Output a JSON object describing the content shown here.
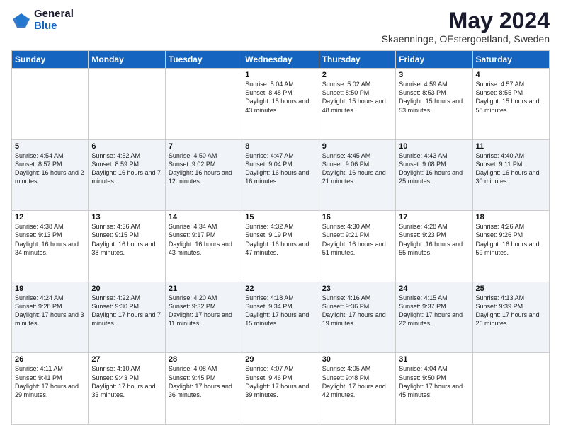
{
  "header": {
    "logo_general": "General",
    "logo_blue": "Blue",
    "month_title": "May 2024",
    "location": "Skaenninge, OEstergoetland, Sweden"
  },
  "days_of_week": [
    "Sunday",
    "Monday",
    "Tuesday",
    "Wednesday",
    "Thursday",
    "Friday",
    "Saturday"
  ],
  "weeks": [
    [
      {
        "day": "",
        "info": ""
      },
      {
        "day": "",
        "info": ""
      },
      {
        "day": "",
        "info": ""
      },
      {
        "day": "1",
        "info": "Sunrise: 5:04 AM\nSunset: 8:48 PM\nDaylight: 15 hours\nand 43 minutes."
      },
      {
        "day": "2",
        "info": "Sunrise: 5:02 AM\nSunset: 8:50 PM\nDaylight: 15 hours\nand 48 minutes."
      },
      {
        "day": "3",
        "info": "Sunrise: 4:59 AM\nSunset: 8:53 PM\nDaylight: 15 hours\nand 53 minutes."
      },
      {
        "day": "4",
        "info": "Sunrise: 4:57 AM\nSunset: 8:55 PM\nDaylight: 15 hours\nand 58 minutes."
      }
    ],
    [
      {
        "day": "5",
        "info": "Sunrise: 4:54 AM\nSunset: 8:57 PM\nDaylight: 16 hours\nand 2 minutes."
      },
      {
        "day": "6",
        "info": "Sunrise: 4:52 AM\nSunset: 8:59 PM\nDaylight: 16 hours\nand 7 minutes."
      },
      {
        "day": "7",
        "info": "Sunrise: 4:50 AM\nSunset: 9:02 PM\nDaylight: 16 hours\nand 12 minutes."
      },
      {
        "day": "8",
        "info": "Sunrise: 4:47 AM\nSunset: 9:04 PM\nDaylight: 16 hours\nand 16 minutes."
      },
      {
        "day": "9",
        "info": "Sunrise: 4:45 AM\nSunset: 9:06 PM\nDaylight: 16 hours\nand 21 minutes."
      },
      {
        "day": "10",
        "info": "Sunrise: 4:43 AM\nSunset: 9:08 PM\nDaylight: 16 hours\nand 25 minutes."
      },
      {
        "day": "11",
        "info": "Sunrise: 4:40 AM\nSunset: 9:11 PM\nDaylight: 16 hours\nand 30 minutes."
      }
    ],
    [
      {
        "day": "12",
        "info": "Sunrise: 4:38 AM\nSunset: 9:13 PM\nDaylight: 16 hours\nand 34 minutes."
      },
      {
        "day": "13",
        "info": "Sunrise: 4:36 AM\nSunset: 9:15 PM\nDaylight: 16 hours\nand 38 minutes."
      },
      {
        "day": "14",
        "info": "Sunrise: 4:34 AM\nSunset: 9:17 PM\nDaylight: 16 hours\nand 43 minutes."
      },
      {
        "day": "15",
        "info": "Sunrise: 4:32 AM\nSunset: 9:19 PM\nDaylight: 16 hours\nand 47 minutes."
      },
      {
        "day": "16",
        "info": "Sunrise: 4:30 AM\nSunset: 9:21 PM\nDaylight: 16 hours\nand 51 minutes."
      },
      {
        "day": "17",
        "info": "Sunrise: 4:28 AM\nSunset: 9:23 PM\nDaylight: 16 hours\nand 55 minutes."
      },
      {
        "day": "18",
        "info": "Sunrise: 4:26 AM\nSunset: 9:26 PM\nDaylight: 16 hours\nand 59 minutes."
      }
    ],
    [
      {
        "day": "19",
        "info": "Sunrise: 4:24 AM\nSunset: 9:28 PM\nDaylight: 17 hours\nand 3 minutes."
      },
      {
        "day": "20",
        "info": "Sunrise: 4:22 AM\nSunset: 9:30 PM\nDaylight: 17 hours\nand 7 minutes."
      },
      {
        "day": "21",
        "info": "Sunrise: 4:20 AM\nSunset: 9:32 PM\nDaylight: 17 hours\nand 11 minutes."
      },
      {
        "day": "22",
        "info": "Sunrise: 4:18 AM\nSunset: 9:34 PM\nDaylight: 17 hours\nand 15 minutes."
      },
      {
        "day": "23",
        "info": "Sunrise: 4:16 AM\nSunset: 9:36 PM\nDaylight: 17 hours\nand 19 minutes."
      },
      {
        "day": "24",
        "info": "Sunrise: 4:15 AM\nSunset: 9:37 PM\nDaylight: 17 hours\nand 22 minutes."
      },
      {
        "day": "25",
        "info": "Sunrise: 4:13 AM\nSunset: 9:39 PM\nDaylight: 17 hours\nand 26 minutes."
      }
    ],
    [
      {
        "day": "26",
        "info": "Sunrise: 4:11 AM\nSunset: 9:41 PM\nDaylight: 17 hours\nand 29 minutes."
      },
      {
        "day": "27",
        "info": "Sunrise: 4:10 AM\nSunset: 9:43 PM\nDaylight: 17 hours\nand 33 minutes."
      },
      {
        "day": "28",
        "info": "Sunrise: 4:08 AM\nSunset: 9:45 PM\nDaylight: 17 hours\nand 36 minutes."
      },
      {
        "day": "29",
        "info": "Sunrise: 4:07 AM\nSunset: 9:46 PM\nDaylight: 17 hours\nand 39 minutes."
      },
      {
        "day": "30",
        "info": "Sunrise: 4:05 AM\nSunset: 9:48 PM\nDaylight: 17 hours\nand 42 minutes."
      },
      {
        "day": "31",
        "info": "Sunrise: 4:04 AM\nSunset: 9:50 PM\nDaylight: 17 hours\nand 45 minutes."
      },
      {
        "day": "",
        "info": ""
      }
    ]
  ]
}
